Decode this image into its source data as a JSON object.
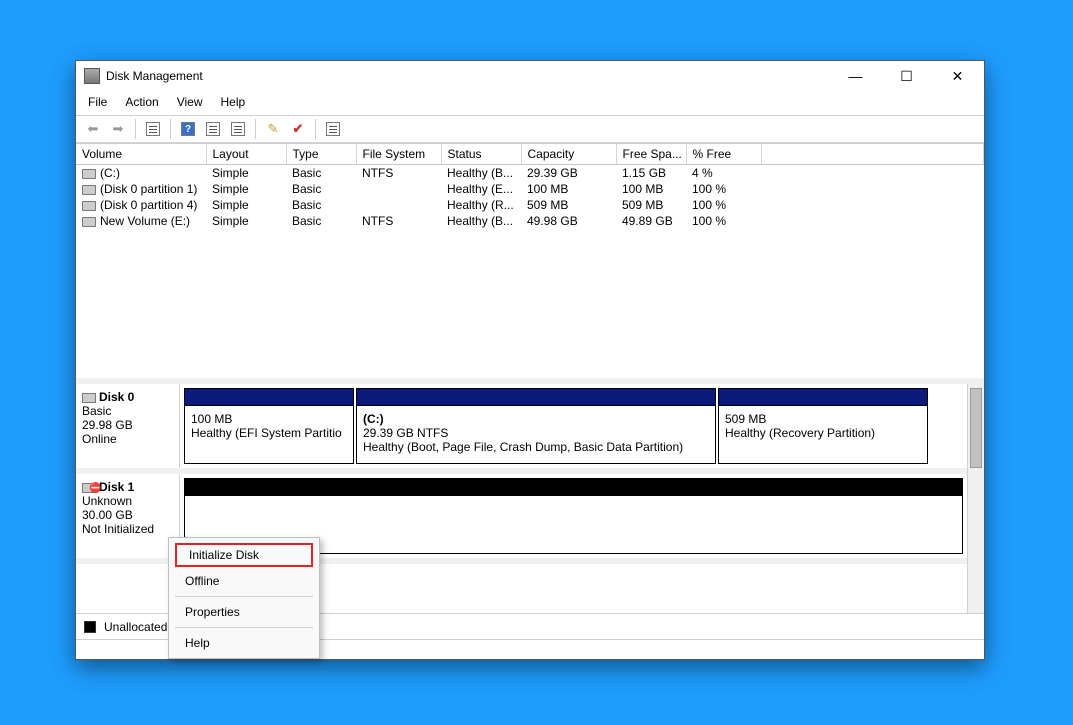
{
  "window": {
    "title": "Disk Management",
    "controls": {
      "minimize": "—",
      "maximize": "☐",
      "close": "✕"
    }
  },
  "menu": {
    "items": [
      "File",
      "Action",
      "View",
      "Help"
    ]
  },
  "volume_table": {
    "headers": [
      "Volume",
      "Layout",
      "Type",
      "File System",
      "Status",
      "Capacity",
      "Free Spa...",
      "% Free"
    ],
    "rows": [
      {
        "volume": "(C:)",
        "layout": "Simple",
        "type": "Basic",
        "fs": "NTFS",
        "status": "Healthy (B...",
        "capacity": "29.39 GB",
        "free": "1.15 GB",
        "pct": "4 %"
      },
      {
        "volume": "(Disk 0 partition 1)",
        "layout": "Simple",
        "type": "Basic",
        "fs": "",
        "status": "Healthy (E...",
        "capacity": "100 MB",
        "free": "100 MB",
        "pct": "100 %"
      },
      {
        "volume": "(Disk 0 partition 4)",
        "layout": "Simple",
        "type": "Basic",
        "fs": "",
        "status": "Healthy (R...",
        "capacity": "509 MB",
        "free": "509 MB",
        "pct": "100 %"
      },
      {
        "volume": "New Volume (E:)",
        "layout": "Simple",
        "type": "Basic",
        "fs": "NTFS",
        "status": "Healthy (B...",
        "capacity": "49.98 GB",
        "free": "49.89 GB",
        "pct": "100 %"
      }
    ]
  },
  "disks": [
    {
      "name": "Disk 0",
      "type": "Basic",
      "size": "29.98 GB",
      "state": "Online",
      "error": false,
      "partitions": [
        {
          "line1": "",
          "line2": "100 MB",
          "line3": "Healthy (EFI System Partitio",
          "stripe": "navy",
          "flex": 170
        },
        {
          "line1": "(C:)",
          "line2": "29.39 GB NTFS",
          "line3": "Healthy (Boot, Page File, Crash Dump, Basic Data Partition)",
          "stripe": "navy",
          "flex": 360
        },
        {
          "line1": "",
          "line2": "509 MB",
          "line3": "Healthy (Recovery Partition)",
          "stripe": "navy",
          "flex": 210
        }
      ]
    },
    {
      "name": "Disk 1",
      "type": "Unknown",
      "size": "30.00 GB",
      "state": "Not Initialized",
      "error": true,
      "partitions": [
        {
          "line1": "",
          "line2": "",
          "line3": "",
          "stripe": "black",
          "flex": 740
        }
      ]
    }
  ],
  "legend": {
    "unallocated": "Unallocated"
  },
  "context_menu": {
    "items": [
      {
        "label": "Initialize Disk",
        "highlight": true
      },
      {
        "label": "Offline",
        "highlight": false
      },
      {
        "sep": true
      },
      {
        "label": "Properties",
        "highlight": false
      },
      {
        "sep": true
      },
      {
        "label": "Help",
        "highlight": false
      }
    ]
  }
}
